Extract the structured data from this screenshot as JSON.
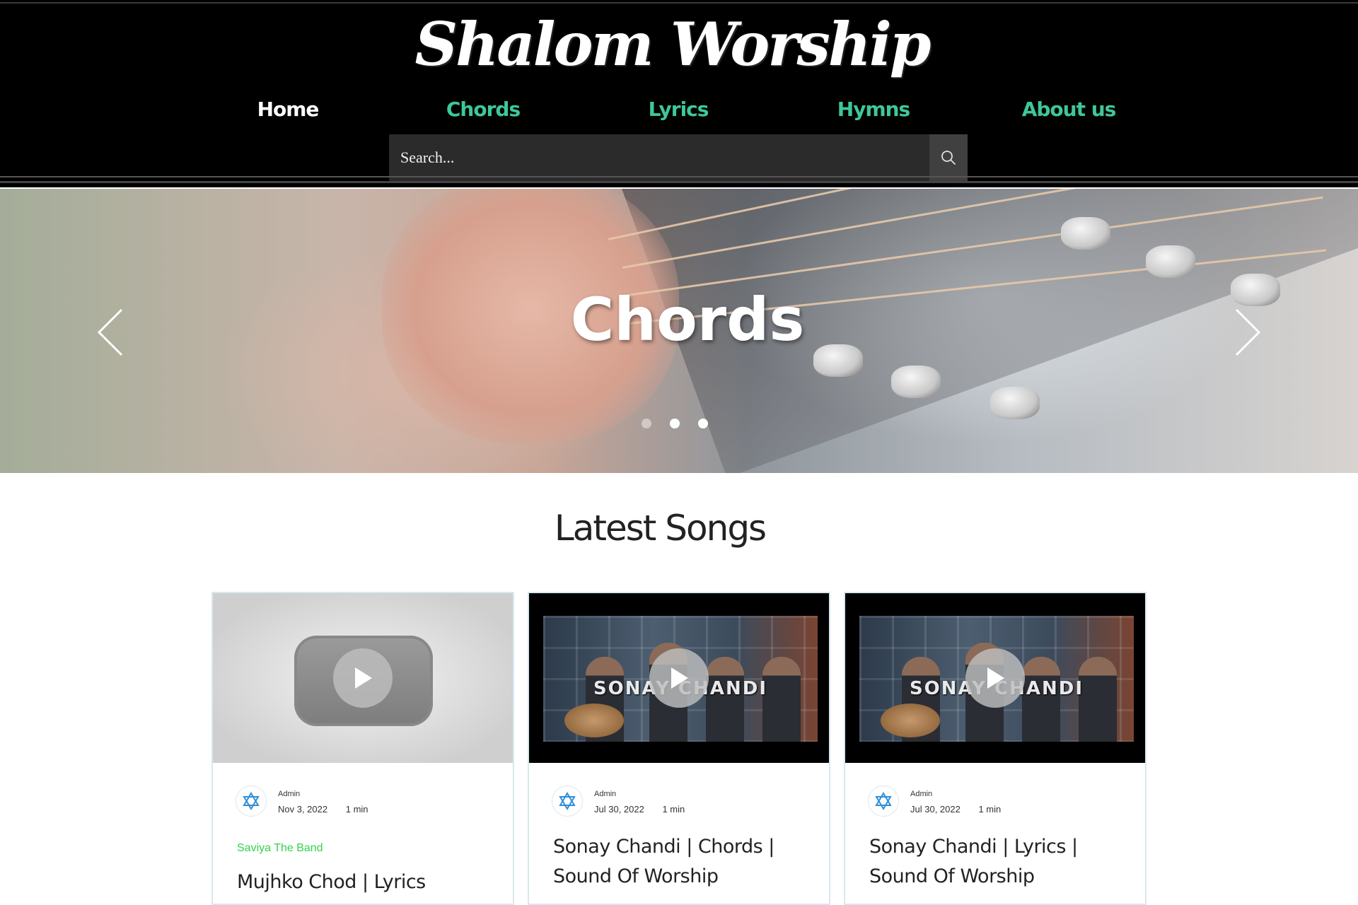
{
  "header": {
    "logo": "Shalom Worship",
    "nav": [
      {
        "label": "Home",
        "active": true
      },
      {
        "label": "Chords",
        "active": false
      },
      {
        "label": "Lyrics",
        "active": false
      },
      {
        "label": "Hymns",
        "active": false
      },
      {
        "label": "About us",
        "active": false
      }
    ],
    "search": {
      "placeholder": "Search..."
    }
  },
  "hero": {
    "title": "Chords",
    "slides_count": 3,
    "active_slide_index": 1
  },
  "latest": {
    "title": "Latest Songs",
    "cards": [
      {
        "thumbnail": "youtube-placeholder",
        "author": "Admin",
        "date": "Nov 3, 2022",
        "read_time": "1 min",
        "category": "Saviya The Band",
        "title": "Mujhko Chod | Lyrics"
      },
      {
        "thumbnail": "video",
        "thumbnail_text": "SONAY CHANDI",
        "author": "Admin",
        "date": "Jul 30, 2022",
        "read_time": "1 min",
        "title": "Sonay Chandi | Chords | Sound Of Worship"
      },
      {
        "thumbnail": "video",
        "thumbnail_text": "SONAY CHANDI",
        "author": "Admin",
        "date": "Jul 30, 2022",
        "read_time": "1 min",
        "title": "Sonay Chandi | Lyrics | Sound Of Worship"
      }
    ]
  },
  "colors": {
    "nav_accent": "#3ec79a",
    "category": "#33d24d",
    "header_bg": "#000000"
  }
}
